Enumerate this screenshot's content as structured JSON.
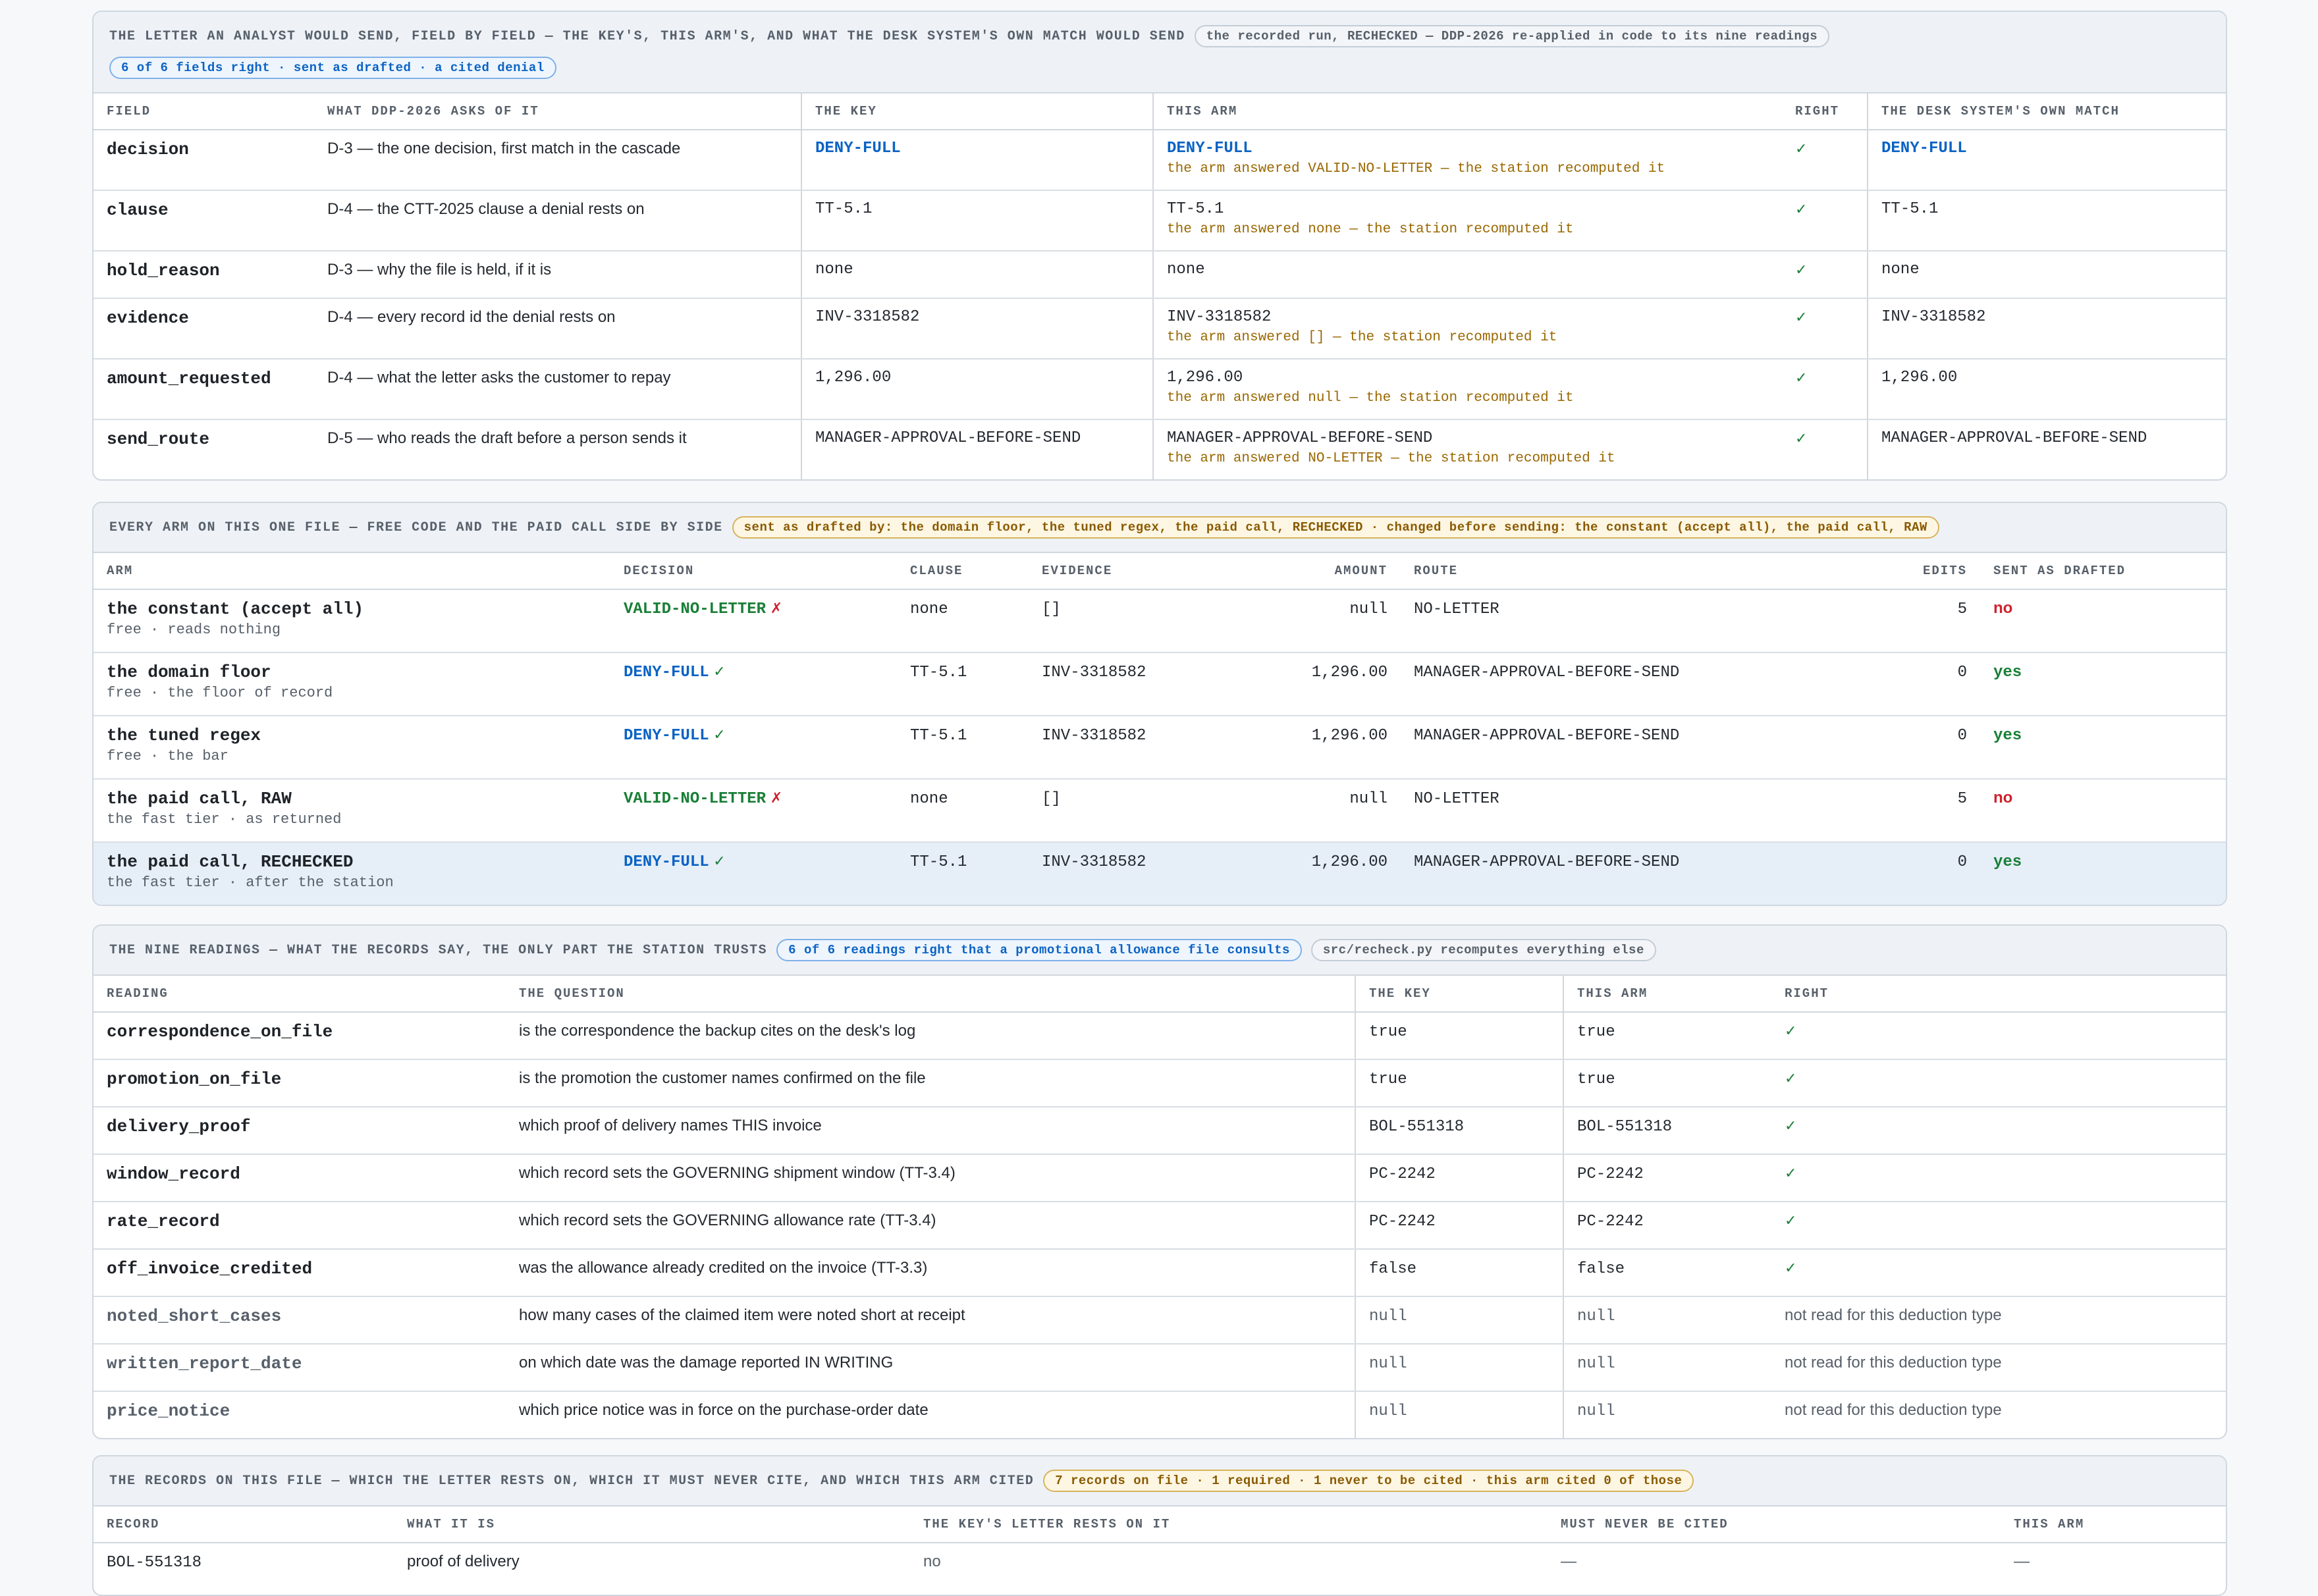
{
  "letter": {
    "title": "THE LETTER AN ANALYST WOULD SEND, FIELD BY FIELD — THE KEY'S, THIS ARM'S, AND WHAT THE DESK SYSTEM'S OWN MATCH WOULD SEND",
    "run_pill": "the recorded run, RECHECKED — DDP-2026 re-applied in code to its nine readings",
    "score_pill": "6 of 6 fields right · sent as drafted · a cited denial",
    "columns": [
      "FIELD",
      "WHAT DDP-2026 ASKS OF IT",
      "THE KEY",
      "THIS ARM",
      "RIGHT",
      "THE DESK SYSTEM'S OWN MATCH"
    ],
    "rows": [
      {
        "field": "decision",
        "asks": "D-3 — the one decision, first match in the cascade",
        "key": "DENY-FULL",
        "arm": "DENY-FULL",
        "arm_note": "the arm answered VALID-NO-LETTER — the station recomputed it",
        "right": "✓",
        "desk": "DENY-FULL"
      },
      {
        "field": "clause",
        "asks": "D-4 — the CTT-2025 clause a denial rests on",
        "key": "TT-5.1",
        "arm": "TT-5.1",
        "arm_note": "the arm answered none — the station recomputed it",
        "right": "✓",
        "desk": "TT-5.1"
      },
      {
        "field": "hold_reason",
        "asks": "D-3 — why the file is held, if it is",
        "key": "none",
        "arm": "none",
        "arm_note": "",
        "right": "✓",
        "desk": "none"
      },
      {
        "field": "evidence",
        "asks": "D-4 — every record id the denial rests on",
        "key": "INV-3318582",
        "arm": "INV-3318582",
        "arm_note": "the arm answered [] — the station recomputed it",
        "right": "✓",
        "desk": "INV-3318582"
      },
      {
        "field": "amount_requested",
        "asks": "D-4 — what the letter asks the customer to repay",
        "key": "1,296.00",
        "arm": "1,296.00",
        "arm_note": "the arm answered null — the station recomputed it",
        "right": "✓",
        "desk": "1,296.00"
      },
      {
        "field": "send_route",
        "asks": "D-5 — who reads the draft before a person sends it",
        "key": "MANAGER-APPROVAL-BEFORE-SEND",
        "arm": "MANAGER-APPROVAL-BEFORE-SEND",
        "arm_note": "the arm answered NO-LETTER — the station recomputed it",
        "right": "✓",
        "desk": "MANAGER-APPROVAL-BEFORE-SEND"
      }
    ]
  },
  "arms": {
    "title": "EVERY ARM ON THIS ONE FILE — FREE CODE AND THE PAID CALL SIDE BY SIDE",
    "summary_pill": "sent as drafted by: the domain floor, the tuned regex, the paid call, RECHECKED · changed before sending: the constant (accept all), the paid call, RAW",
    "columns": [
      "ARM",
      "DECISION",
      "CLAUSE",
      "EVIDENCE",
      "AMOUNT",
      "ROUTE",
      "EDITS",
      "SENT AS DRAFTED"
    ],
    "rows": [
      {
        "name": "the constant (accept all)",
        "sub": "free · reads nothing",
        "decision": "VALID-NO-LETTER",
        "mark": "✗",
        "clause": "none",
        "evidence": "[]",
        "amount": "null",
        "route": "NO-LETTER",
        "edits": "5",
        "sent": "no"
      },
      {
        "name": "the domain floor",
        "sub": "free · the floor of record",
        "decision": "DENY-FULL",
        "mark": "✓",
        "clause": "TT-5.1",
        "evidence": "INV-3318582",
        "amount": "1,296.00",
        "route": "MANAGER-APPROVAL-BEFORE-SEND",
        "edits": "0",
        "sent": "yes"
      },
      {
        "name": "the tuned regex",
        "sub": "free · the bar",
        "decision": "DENY-FULL",
        "mark": "✓",
        "clause": "TT-5.1",
        "evidence": "INV-3318582",
        "amount": "1,296.00",
        "route": "MANAGER-APPROVAL-BEFORE-SEND",
        "edits": "0",
        "sent": "yes"
      },
      {
        "name": "the paid call, RAW",
        "sub": "the fast tier · as returned",
        "decision": "VALID-NO-LETTER",
        "mark": "✗",
        "clause": "none",
        "evidence": "[]",
        "amount": "null",
        "route": "NO-LETTER",
        "edits": "5",
        "sent": "no"
      },
      {
        "name": "the paid call, RECHECKED",
        "sub": "the fast tier · after the station",
        "decision": "DENY-FULL",
        "mark": "✓",
        "clause": "TT-5.1",
        "evidence": "INV-3318582",
        "amount": "1,296.00",
        "route": "MANAGER-APPROVAL-BEFORE-SEND",
        "edits": "0",
        "sent": "yes"
      }
    ]
  },
  "readings": {
    "title": "THE NINE READINGS — WHAT THE RECORDS SAY, THE ONLY PART THE STATION TRUSTS",
    "score_pill": "6 of 6 readings right that a promotional allowance file consults",
    "code_pill": "src/recheck.py recomputes everything else",
    "columns": [
      "READING",
      "THE QUESTION",
      "THE KEY",
      "THIS ARM",
      "RIGHT"
    ],
    "rows": [
      {
        "name": "correspondence_on_file",
        "question": "is the correspondence the backup cites on the desk's log",
        "key": "true",
        "arm": "true",
        "right": "✓",
        "muted": false
      },
      {
        "name": "promotion_on_file",
        "question": "is the promotion the customer names confirmed on the file",
        "key": "true",
        "arm": "true",
        "right": "✓",
        "muted": false
      },
      {
        "name": "delivery_proof",
        "question": "which proof of delivery names THIS invoice",
        "key": "BOL-551318",
        "arm": "BOL-551318",
        "right": "✓",
        "muted": false
      },
      {
        "name": "window_record",
        "question": "which record sets the GOVERNING shipment window (TT-3.4)",
        "key": "PC-2242",
        "arm": "PC-2242",
        "right": "✓",
        "muted": false
      },
      {
        "name": "rate_record",
        "question": "which record sets the GOVERNING allowance rate (TT-3.4)",
        "key": "PC-2242",
        "arm": "PC-2242",
        "right": "✓",
        "muted": false
      },
      {
        "name": "off_invoice_credited",
        "question": "was the allowance already credited on the invoice (TT-3.3)",
        "key": "false",
        "arm": "false",
        "right": "✓",
        "muted": false
      },
      {
        "name": "noted_short_cases",
        "question": "how many cases of the claimed item were noted short at receipt",
        "key": "null",
        "arm": "null",
        "right": "not read for this deduction type",
        "muted": true
      },
      {
        "name": "written_report_date",
        "question": "on which date was the damage reported IN WRITING",
        "key": "null",
        "arm": "null",
        "right": "not read for this deduction type",
        "muted": true
      },
      {
        "name": "price_notice",
        "question": "which price notice was in force on the purchase-order date",
        "key": "null",
        "arm": "null",
        "right": "not read for this deduction type",
        "muted": true
      }
    ]
  },
  "records": {
    "title": "THE RECORDS ON THIS FILE — WHICH THE LETTER RESTS ON, WHICH IT MUST NEVER CITE, AND WHICH THIS ARM CITED",
    "summary_pill": "7 records on file · 1 required · 1 never to be cited · this arm cited 0 of those",
    "columns": [
      "RECORD",
      "WHAT IT IS",
      "THE KEY'S LETTER RESTS ON IT",
      "MUST NEVER BE CITED",
      "THIS ARM"
    ],
    "rows": [
      {
        "record": "BOL-551318",
        "what": "proof of delivery",
        "rests": "no",
        "never": "—",
        "arm": "—"
      }
    ]
  }
}
